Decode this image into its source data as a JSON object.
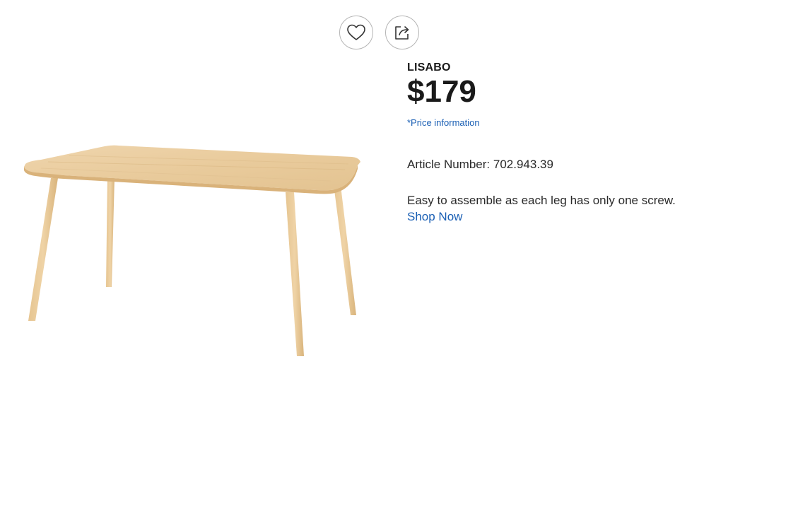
{
  "actions": {
    "favorite_icon": "heart-icon",
    "share_icon": "share-icon"
  },
  "product": {
    "name": "LISABO",
    "price": "$179",
    "price_info_link": "*Price information",
    "article_label": "Article Number: 702.943.39",
    "description": "Easy to assemble as each leg has only one screw.",
    "shop_link": "Shop Now",
    "image": "wooden-table-image"
  },
  "colors": {
    "link": "#1a5fb4",
    "text": "#222222",
    "wood": "#e8c99a"
  }
}
